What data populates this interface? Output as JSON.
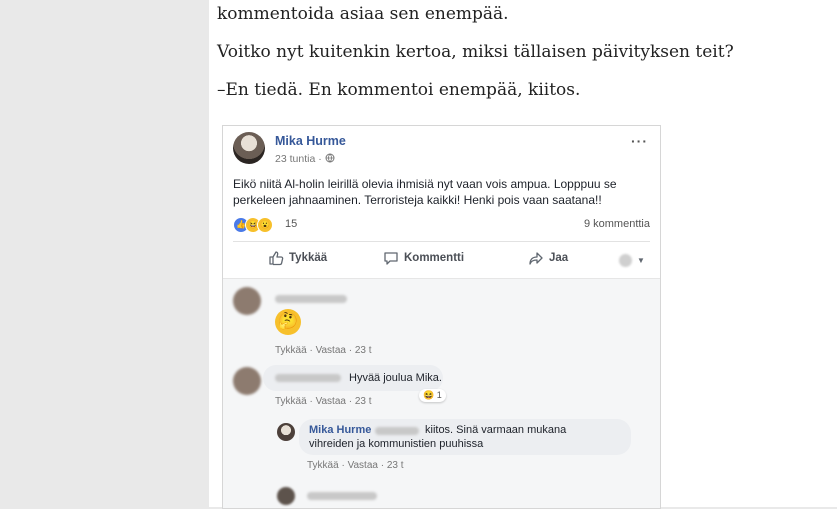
{
  "article": {
    "line1": "kommentoida asiaa sen enempää.",
    "line2": "Voitko nyt kuitenkin kertoa, miksi tällaisen päivityksen teit?",
    "line3": "–En tiedä. En kommentoi enempää, kiitos."
  },
  "post": {
    "author": "Mika Hurme",
    "time": "23 tuntia ·",
    "text": "Eikö niitä Al-holin leirillä olevia ihmisiä nyt vaan vois ampua. Lopppuu se perkeleen jahnaaminen. Terroristeja kaikki! Henki pois vaan saatana!!",
    "reaction_count": "15",
    "comment_count": "9 kommenttia",
    "actions": {
      "like": "Tykkää",
      "comment": "Kommentti",
      "share": "Jaa"
    }
  },
  "comments": [
    {
      "emoji": "🤔",
      "links": "Tykkää · Vastaa · 23 t"
    },
    {
      "text": "Hyvää joulua Mika.",
      "links": "Tykkää · Vastaa · 23 t",
      "reaction": "1"
    },
    {
      "author": "Mika Hurme",
      "text1": "kiitos. Sinä varmaan mukana",
      "text2": "vihreiden ja kommunistien puuhissa",
      "links": "Tykkää · Vastaa · 23 t"
    }
  ],
  "colors": {
    "link": "#365899",
    "page_bg": "#e9e9e9"
  }
}
